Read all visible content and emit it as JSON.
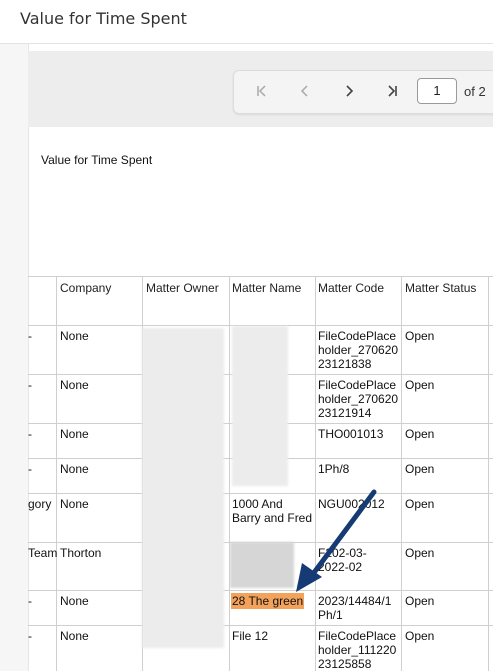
{
  "window": {
    "title": "Value for Time Spent"
  },
  "pager": {
    "current_page": "1",
    "of_label": "of 2",
    "first_icon": "first-page-icon",
    "prev_icon": "chevron-left-icon",
    "next_icon": "chevron-right-icon",
    "last_icon": "last-page-icon"
  },
  "report": {
    "title": "Value for Time Spent",
    "columns": [
      "Company",
      "Matter Owner",
      "Matter Name",
      "Matter Code",
      "Matter Status"
    ],
    "rows": [
      {
        "lead": "-",
        "company": "None",
        "matter_name": "",
        "matter_code": [
          "FileCodePlace",
          "holder_270620",
          "23121838"
        ],
        "status": "Open"
      },
      {
        "lead": "-",
        "company": "None",
        "matter_name": "",
        "matter_code": [
          "FileCodePlace",
          "holder_270620",
          "23121914"
        ],
        "status": "Open"
      },
      {
        "lead": "-",
        "company": "None",
        "matter_name": "",
        "matter_code": [
          "THO001013"
        ],
        "status": "Open"
      },
      {
        "lead": "-",
        "company": "None",
        "matter_name": "",
        "matter_code": [
          "1Ph/8"
        ],
        "status": "Open"
      },
      {
        "lead": "gory",
        "company": "None",
        "matter_name": [
          "1000 And",
          "Barry and Fred"
        ],
        "matter_code": [
          "NGU002012"
        ],
        "status": "Open"
      },
      {
        "lead": "Team",
        "company": "Thorton",
        "matter_name": "",
        "matter_code": [
          "F202-03-",
          "2022-02"
        ],
        "status": "Open"
      },
      {
        "lead": "-",
        "company": "None",
        "matter_name": [
          "28 The green"
        ],
        "matter_code": [
          "2023/14484/1",
          "Ph/1"
        ],
        "status": "Open"
      },
      {
        "lead": "-",
        "company": "None",
        "matter_name": [
          "File 12"
        ],
        "matter_code": [
          "FileCodePlace",
          "holder_111220",
          "23125858"
        ],
        "status": "Open"
      }
    ]
  },
  "annotation": {
    "arrow_color": "#163a73",
    "highlight_color": "#f2a25a"
  }
}
